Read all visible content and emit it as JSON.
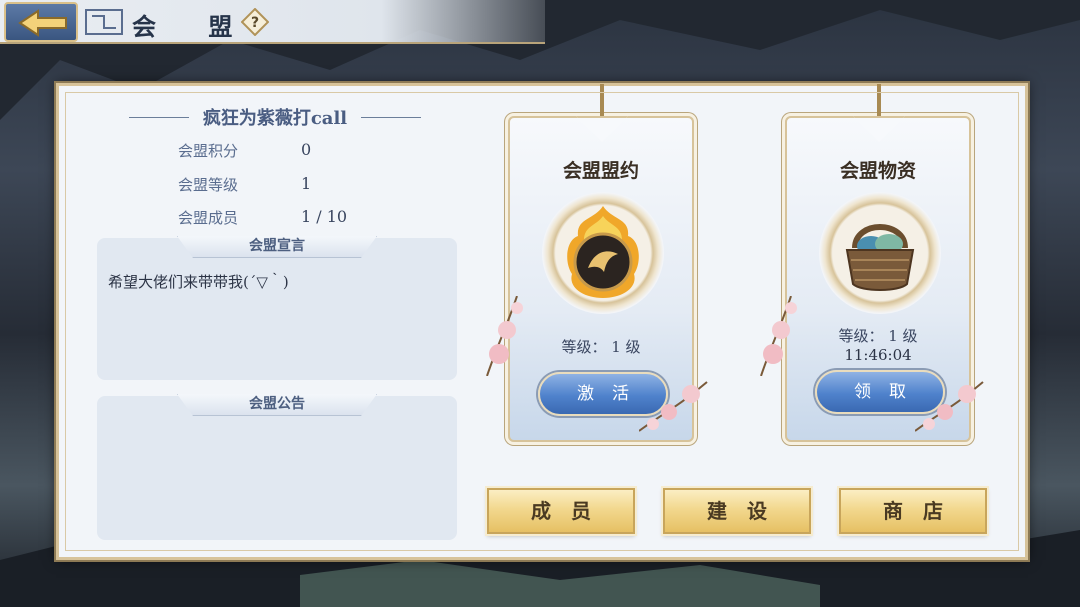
{
  "header": {
    "title": "会 盟",
    "back_icon": "back-arrow-icon",
    "help_icon": "question-icon",
    "help_symbol": "?"
  },
  "guild": {
    "name": "疯狂为紫薇打call",
    "stats": [
      {
        "label": "会盟积分",
        "value": "0"
      },
      {
        "label": "会盟等级",
        "value": "1"
      },
      {
        "label": "会盟成员",
        "value": "1 / 10"
      }
    ],
    "declaration": {
      "title": "会盟宣言",
      "text": "希望大佬们来带带我(´▽｀)"
    },
    "notice": {
      "title": "会盟公告",
      "text": ""
    }
  },
  "cards": {
    "pact": {
      "title": "会盟盟约",
      "level": "等级： 1 级",
      "button": "激活",
      "icon": "flaming-orb-icon"
    },
    "supplies": {
      "title": "会盟物资",
      "level": "等级： 1 级",
      "timer": "11:46:04",
      "button": "领取",
      "icon": "supply-basket-icon"
    }
  },
  "actions": {
    "members": "成员",
    "build": "建设",
    "shop": "商店"
  },
  "colors": {
    "gold": "#e6c064",
    "blue_button": "#4f82cc",
    "panel": "#f2f5f9"
  }
}
